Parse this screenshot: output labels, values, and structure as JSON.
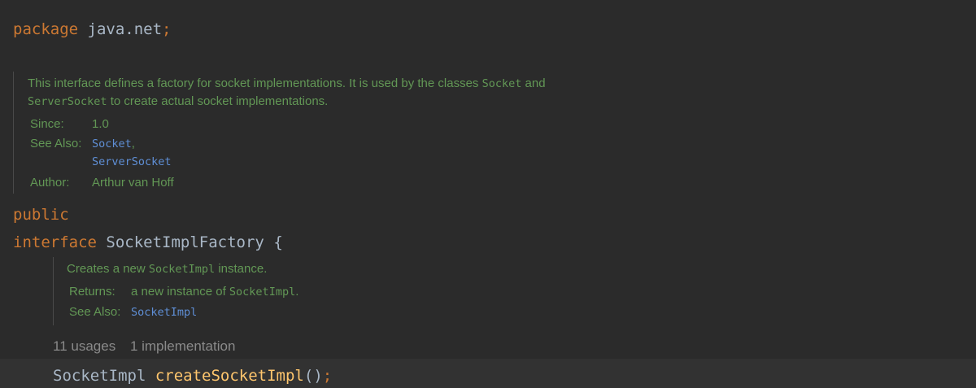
{
  "package_line": {
    "keyword": "package",
    "name": "java.net",
    "semicolon": ";"
  },
  "class_doc": {
    "text_1": "This interface defines a factory for socket implementations. It is used by the classes ",
    "code_1": "Socket",
    "text_2": " and",
    "code_2": "ServerSocket",
    "text_3": " to create actual socket implementations.",
    "since_label": "Since:",
    "since_value": "1.0",
    "see_also_label": "See Also:",
    "see_also_1": "Socket",
    "see_also_comma": ",",
    "see_also_2": "ServerSocket",
    "author_label": "Author:",
    "author_value": "Arthur van Hoff"
  },
  "modifier_line": {
    "keyword": "public"
  },
  "interface_line": {
    "keyword": "interface",
    "name": "SocketImplFactory",
    "brace": "{"
  },
  "method_doc": {
    "text_1": "Creates a new ",
    "code_1": "SocketImpl",
    "text_2": " instance.",
    "returns_label": "Returns:",
    "returns_text": "a new instance of ",
    "returns_code": "SocketImpl",
    "returns_end": ".",
    "see_also_label": "See Also:",
    "see_also_1": "SocketImpl"
  },
  "hints": {
    "usages": "11 usages",
    "implementations": "1 implementation"
  },
  "method_line": {
    "return_type": "SocketImpl",
    "name": "createSocketImpl",
    "parens": "()",
    "semicolon": ";"
  },
  "colors": {
    "background": "#2b2b2b",
    "keyword": "#cc7832",
    "method": "#ffc66d",
    "identifier": "#a9b7c6",
    "javadoc": "#629755",
    "link": "#5f8fd6",
    "hint": "#8a8a8a"
  }
}
